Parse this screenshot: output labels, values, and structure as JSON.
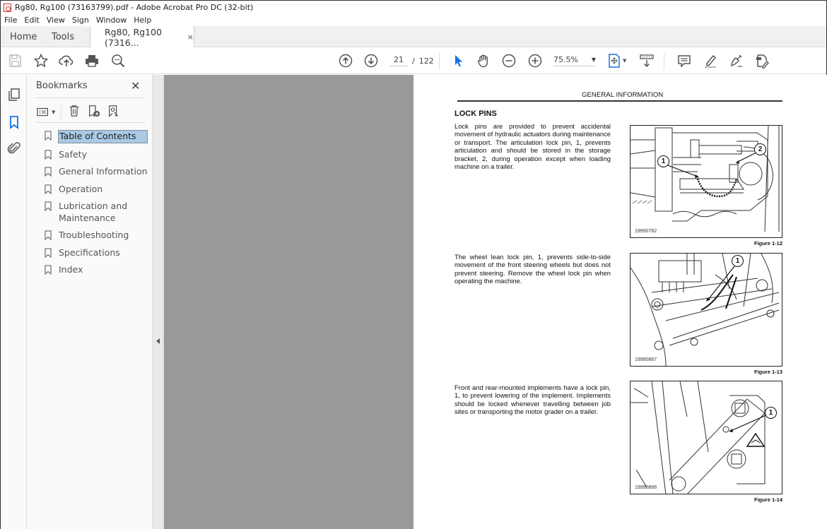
{
  "window": {
    "title": "Rg80, Rg100 (73163799).pdf - Adobe Acrobat Pro DC (32-bit)"
  },
  "menu": [
    "File",
    "Edit",
    "View",
    "Sign",
    "Window",
    "Help"
  ],
  "tabs": {
    "home": "Home",
    "tools": "Tools",
    "document": "Rg80, Rg100 (7316...",
    "close_glyph": "×"
  },
  "toolbar": {
    "current_page": "21",
    "page_separator": "/",
    "total_pages": "122",
    "zoom_level": "75.5%",
    "icons": [
      "save-icon",
      "bookmark-star-icon",
      "cloud-upload-icon",
      "print-icon",
      "find-icon",
      "page-up-icon",
      "page-down-icon",
      "select-arrow-icon",
      "hand-icon",
      "zoom-out-icon",
      "zoom-in-icon",
      "fit-page-icon",
      "scroll-mode-icon",
      "comment-icon",
      "highlight-icon",
      "sign-icon",
      "redact-icon"
    ]
  },
  "bookmarks": {
    "title": "Bookmarks",
    "close_glyph": "✕",
    "items": [
      {
        "label": "Table of Contents",
        "selected": true
      },
      {
        "label": "Safety"
      },
      {
        "label": "General Information"
      },
      {
        "label": "Operation"
      },
      {
        "label": "Lubrication and Maintenance"
      },
      {
        "label": "Troubleshooting"
      },
      {
        "label": "Specifications"
      },
      {
        "label": "Index"
      }
    ]
  },
  "document": {
    "header": "GENERAL INFORMATION",
    "heading": "LOCK PINS",
    "paragraphs": [
      "Lock pins are provided to prevent accidental movement of hydraulic actuators during maintenance or transport. The articulation lock pin, 1, prevents articulation and should be stored in the storage bracket, 2, during operation except when loading machine on a trailer.",
      "The wheel lean lock pin, 1, prevents side-to-side movement of the front steering wheels but does not prevent steering. Remove the wheel lock pin when operating the machine.",
      "Front and rear-mounted implements have a lock pin, 1, to prevent lowering of the implement. Implements should be locked whenever travelling between job sites or transporting the motor grader on a trailer."
    ],
    "figures": [
      {
        "id": "19990782",
        "caption": "Figure 1-12",
        "callouts": [
          "1",
          "2"
        ]
      },
      {
        "id": "19990867",
        "caption": "Figure 1-13",
        "callouts": [
          "1"
        ]
      },
      {
        "id": "19990866",
        "caption": "Figure 1-14",
        "callouts": [
          "1"
        ]
      }
    ]
  }
}
